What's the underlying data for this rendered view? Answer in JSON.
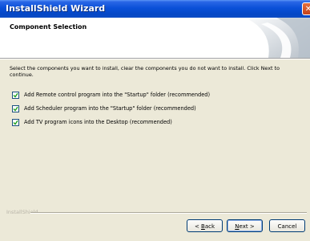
{
  "window": {
    "title": "InstallShield Wizard",
    "close_glyph": "✕"
  },
  "header": {
    "title": "Component Selection"
  },
  "description": "Select the components you want to install, clear the components you do not want to install. Click Next to continue.",
  "options": [
    {
      "label": "Add Remote control program into the \"Startup\" folder (recommended)",
      "checked": true
    },
    {
      "label": "Add Scheduler program into the \"Startup\" folder (recommended)",
      "checked": true
    },
    {
      "label": "Add TV program icons into the Desktop (recommended)",
      "checked": true
    }
  ],
  "footer": {
    "brand": "InstallShield",
    "back": {
      "pre": "< ",
      "key": "B",
      "rest": "ack"
    },
    "next": {
      "key": "N",
      "rest": "ext >"
    },
    "cancel": "Cancel"
  }
}
